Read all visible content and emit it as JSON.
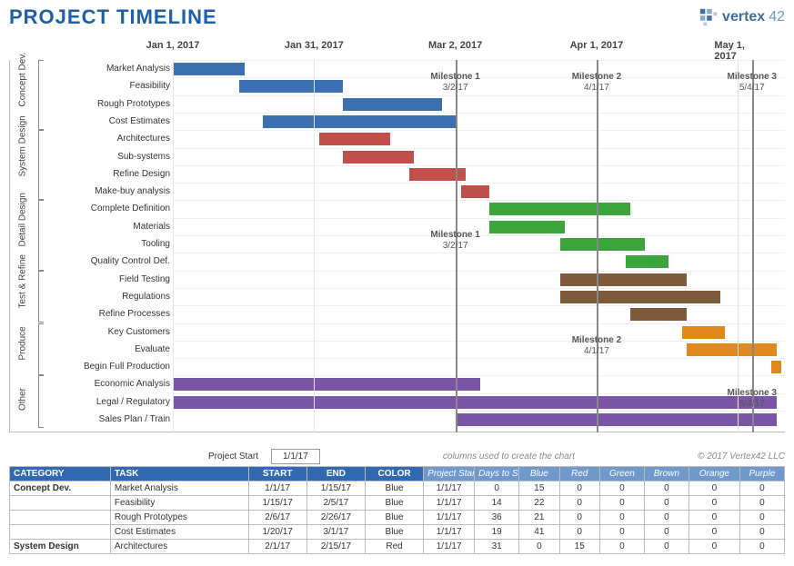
{
  "title": "PROJECT TIMELINE",
  "brand": {
    "name": "vertex",
    "suffix": "42"
  },
  "chart_data": {
    "type": "bar",
    "orientation": "horizontal-gantt",
    "x_axis_type": "date",
    "x_start": "2017-01-01",
    "x_ticks": [
      {
        "label": "Jan 1, 2017",
        "pos": 0
      },
      {
        "label": "Jan 31, 2017",
        "pos": 30
      },
      {
        "label": "Mar 2, 2017",
        "pos": 60
      },
      {
        "label": "Apr 1, 2017",
        "pos": 90
      },
      {
        "label": "May 1, 2017",
        "pos": 120
      }
    ],
    "x_range_days": 130,
    "milestones": [
      {
        "name": "Milestone 1",
        "date": "3/2/17",
        "pos": 60,
        "text_rows": [
          1,
          10
        ]
      },
      {
        "name": "Milestone 2",
        "date": "4/1/17",
        "pos": 90,
        "text_rows": [
          1,
          16
        ]
      },
      {
        "name": "Milestone 3",
        "date": "5/4/17",
        "pos": 123,
        "text_rows": [
          1,
          19
        ]
      }
    ],
    "groups": [
      {
        "name": "Concept\nDev.",
        "rows": [
          0,
          3
        ]
      },
      {
        "name": "System\nDesign",
        "rows": [
          4,
          7
        ]
      },
      {
        "name": "Detail\nDesign",
        "rows": [
          8,
          11
        ]
      },
      {
        "name": "Test &\nRefine",
        "rows": [
          12,
          14
        ]
      },
      {
        "name": "Produce",
        "rows": [
          15,
          17
        ]
      },
      {
        "name": "Other",
        "rows": [
          18,
          20
        ]
      }
    ],
    "colors": {
      "Blue": "#3d70b2",
      "Red": "#c1504c",
      "Green": "#3ba43b",
      "Brown": "#7d5a3a",
      "Orange": "#e08a1e",
      "Purple": "#7b55a6"
    },
    "tasks": [
      {
        "label": "Market Analysis",
        "start": 0,
        "len": 15,
        "color": "Blue"
      },
      {
        "label": "Feasibility",
        "start": 14,
        "len": 22,
        "color": "Blue"
      },
      {
        "label": "Rough Prototypes",
        "start": 36,
        "len": 21,
        "color": "Blue"
      },
      {
        "label": "Cost Estimates",
        "start": 19,
        "len": 41,
        "color": "Blue"
      },
      {
        "label": "Architectures",
        "start": 31,
        "len": 15,
        "color": "Red"
      },
      {
        "label": "Sub-systems",
        "start": 36,
        "len": 15,
        "color": "Red"
      },
      {
        "label": "Refine Design",
        "start": 50,
        "len": 12,
        "color": "Red"
      },
      {
        "label": "Make-buy analysis",
        "start": 61,
        "len": 6,
        "color": "Red"
      },
      {
        "label": "Complete Definition",
        "start": 67,
        "len": 30,
        "color": "Green"
      },
      {
        "label": "Materials",
        "start": 67,
        "len": 16,
        "color": "Green"
      },
      {
        "label": "Tooling",
        "start": 82,
        "len": 18,
        "color": "Green"
      },
      {
        "label": "Quality Control Def.",
        "start": 96,
        "len": 9,
        "color": "Green"
      },
      {
        "label": "Field Testing",
        "start": 82,
        "len": 27,
        "color": "Brown"
      },
      {
        "label": "Regulations",
        "start": 82,
        "len": 34,
        "color": "Brown"
      },
      {
        "label": "Refine Processes",
        "start": 97,
        "len": 12,
        "color": "Brown"
      },
      {
        "label": "Key Customers",
        "start": 108,
        "len": 9,
        "color": "Orange"
      },
      {
        "label": "Evaluate",
        "start": 109,
        "len": 19,
        "color": "Orange"
      },
      {
        "label": "Begin Full Production",
        "start": 127,
        "len": 2,
        "color": "Orange"
      },
      {
        "label": "Economic Analysis",
        "start": 0,
        "len": 65,
        "color": "Purple"
      },
      {
        "label": "Legal / Regulatory",
        "start": 0,
        "len": 128,
        "color": "Purple"
      },
      {
        "label": "Sales Plan / Train",
        "start": 60,
        "len": 68,
        "color": "Purple"
      }
    ]
  },
  "meta": {
    "project_start_label": "Project Start",
    "project_start_value": "1/1/17",
    "note": "columns used to create the chart",
    "copyright": "© 2017 Vertex42 LLC"
  },
  "table": {
    "headers_main": [
      "CATEGORY",
      "TASK",
      "START",
      "END",
      "COLOR"
    ],
    "headers_light": [
      "Project Start",
      "Days to Start",
      "Blue",
      "Red",
      "Green",
      "Brown",
      "Orange",
      "Purple"
    ],
    "rows": [
      {
        "cat": "Concept Dev.",
        "task": "Market Analysis",
        "start": "1/1/17",
        "end": "1/15/17",
        "color": "Blue",
        "ps": "1/1/17",
        "dts": 0,
        "v": [
          15,
          0,
          0,
          0,
          0,
          0
        ]
      },
      {
        "cat": "",
        "task": "Feasibility",
        "start": "1/15/17",
        "end": "2/5/17",
        "color": "Blue",
        "ps": "1/1/17",
        "dts": 14,
        "v": [
          22,
          0,
          0,
          0,
          0,
          0
        ]
      },
      {
        "cat": "",
        "task": "Rough Prototypes",
        "start": "2/6/17",
        "end": "2/26/17",
        "color": "Blue",
        "ps": "1/1/17",
        "dts": 36,
        "v": [
          21,
          0,
          0,
          0,
          0,
          0
        ]
      },
      {
        "cat": "",
        "task": "Cost Estimates",
        "start": "1/20/17",
        "end": "3/1/17",
        "color": "Blue",
        "ps": "1/1/17",
        "dts": 19,
        "v": [
          41,
          0,
          0,
          0,
          0,
          0
        ]
      },
      {
        "cat": "System Design",
        "task": "Architectures",
        "start": "2/1/17",
        "end": "2/15/17",
        "color": "Red",
        "ps": "1/1/17",
        "dts": 31,
        "v": [
          0,
          15,
          0,
          0,
          0,
          0
        ]
      }
    ]
  }
}
